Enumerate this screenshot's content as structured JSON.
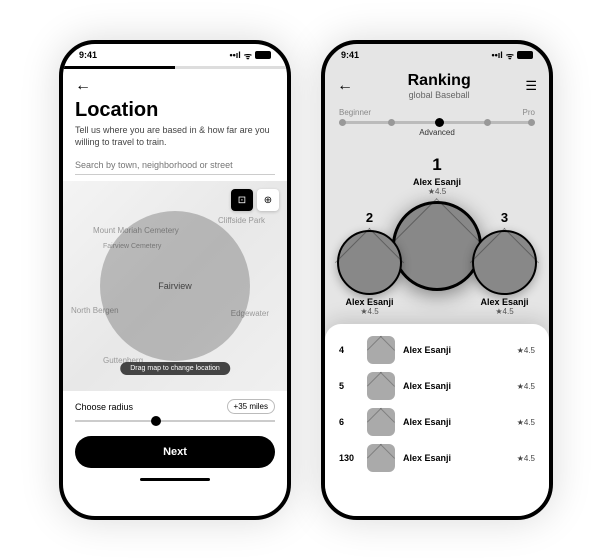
{
  "status": {
    "time": "9:41"
  },
  "left": {
    "heading": "Location",
    "subtitle": "Tell us where you are based in & how far are you willing to travel to train.",
    "search_placeholder": "Search by town, neighborhood or street",
    "map": {
      "drag_hint": "Drag map to change location",
      "labels": {
        "mount_moriah": "Mount Moriah Cemetery",
        "cliffside": "Cliffside Park",
        "north_bergen": "North Bergen",
        "edgewater": "Edgewater",
        "fairview": "Fairview",
        "guttenberg": "Guttenberg",
        "fairview_cemetery": "Fairview Cemetery"
      }
    },
    "radius_label": "Choose radius",
    "radius_value": "+35 miles",
    "next_button": "Next"
  },
  "right": {
    "title": "Ranking",
    "subtitle": "global Baseball",
    "levels": {
      "left": "Beginner",
      "right": "Pro",
      "current": "Advanced"
    },
    "podium": {
      "first": {
        "pos": "1",
        "name": "Alex Esanji",
        "rating": "★4.5"
      },
      "second": {
        "pos": "2",
        "name": "Alex Esanji",
        "rating": "★4.5"
      },
      "third": {
        "pos": "3",
        "name": "Alex Esanji",
        "rating": "★4.5"
      }
    },
    "list": [
      {
        "pos": "4",
        "name": "Alex Esanji",
        "rating": "★4.5"
      },
      {
        "pos": "5",
        "name": "Alex Esanji",
        "rating": "★4.5"
      },
      {
        "pos": "6",
        "name": "Alex Esanji",
        "rating": "★4.5"
      },
      {
        "pos": "130",
        "name": "Alex Esanji",
        "rating": "★4.5"
      }
    ]
  }
}
